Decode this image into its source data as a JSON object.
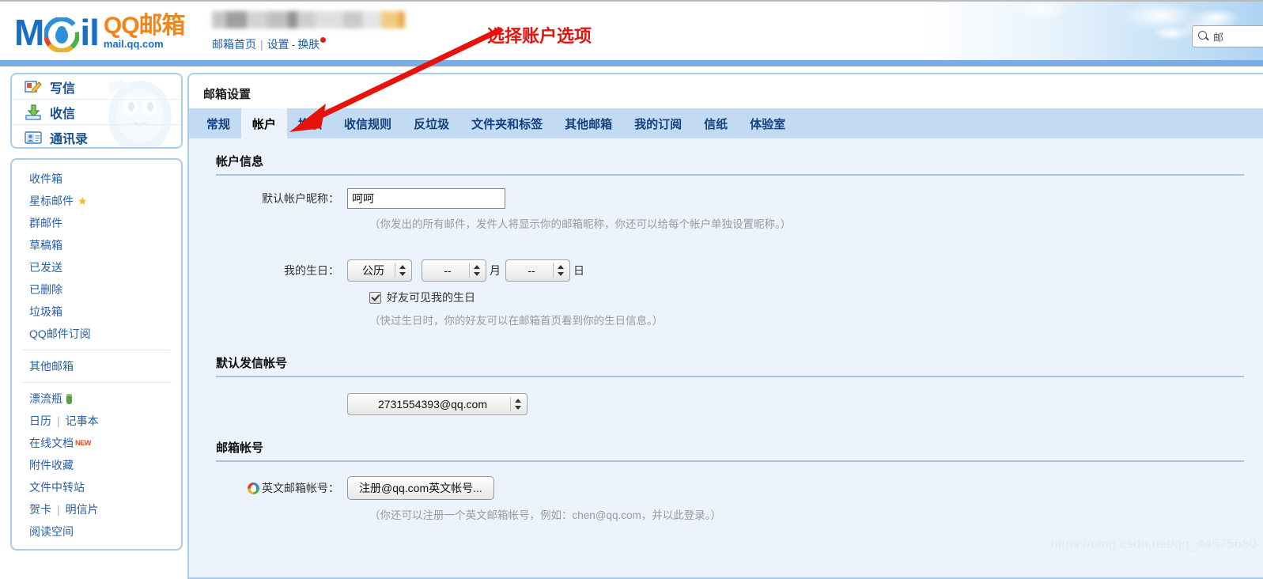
{
  "header": {
    "logo_m": "M",
    "logo_il": "il",
    "logo_qq": "QQ邮箱",
    "logo_url": "mail.qq.com",
    "links": {
      "home": "邮箱首页",
      "separator": "|",
      "settings": "设置",
      "dash": "-",
      "skin": "换肤"
    },
    "search_placeholder": "邮",
    "search_icon": "search-icon"
  },
  "sidebar": {
    "primary": [
      {
        "label": "写信",
        "icon": "compose-icon"
      },
      {
        "label": "收信",
        "icon": "inbox-download-icon"
      },
      {
        "label": "通讯录",
        "icon": "contacts-icon"
      }
    ],
    "folders": [
      {
        "label": "收件箱"
      },
      {
        "label": "星标邮件",
        "badge": "star-icon"
      },
      {
        "label": "群邮件"
      },
      {
        "label": "草稿箱"
      },
      {
        "label": "已发送"
      },
      {
        "label": "已删除"
      },
      {
        "label": "垃圾箱"
      },
      {
        "label": "QQ邮件订阅"
      }
    ],
    "other": [
      {
        "label": "其他邮箱"
      }
    ],
    "tools": [
      {
        "label": "漂流瓶",
        "badge": "bottle-icon"
      },
      {
        "label": "日历",
        "label2": "记事本",
        "sep": "|"
      },
      {
        "label": "在线文档",
        "tag": "NEW"
      },
      {
        "label": "附件收藏"
      },
      {
        "label": "文件中转站"
      },
      {
        "label": "贺卡",
        "label2": "明信片",
        "sep": "|"
      },
      {
        "label": "阅读空间"
      }
    ]
  },
  "main": {
    "page_title": "邮箱设置",
    "tabs": [
      {
        "label": "常规",
        "active": false
      },
      {
        "label": "帐户",
        "active": true
      },
      {
        "label": "换肤",
        "active": false
      },
      {
        "label": "收信规则",
        "active": false
      },
      {
        "label": "反垃圾",
        "active": false
      },
      {
        "label": "文件夹和标签",
        "active": false
      },
      {
        "label": "其他邮箱",
        "active": false
      },
      {
        "label": "我的订阅",
        "active": false
      },
      {
        "label": "信纸",
        "active": false
      },
      {
        "label": "体验室",
        "active": false
      }
    ],
    "sections": {
      "account_info": {
        "heading": "帐户信息",
        "nickname_label": "默认帐户昵称：",
        "nickname_value": "呵呵",
        "nickname_hint": "（你发出的所有邮件，发件人将显示你的邮箱昵称，你还可以给每个帐户单独设置昵称。）",
        "birthday_label": "我的生日：",
        "birthday_calendar": "公历",
        "birthday_month": "--",
        "birthday_month_unit": "月",
        "birthday_day": "--",
        "birthday_day_unit": "日",
        "birthday_checkbox_label": "好友可见我的生日",
        "birthday_checkbox_checked": true,
        "birthday_hint": "（快过生日时，你的好友可以在邮箱首页看到你的生日信息。）"
      },
      "default_sender": {
        "heading": "默认发信帐号",
        "selected_account": "2731554393@qq.com"
      },
      "mail_account": {
        "heading": "邮箱帐号",
        "english_label": "英文邮箱帐号：",
        "english_icon": "qq-logo-icon",
        "english_button": "注册@qq.com英文帐号...",
        "english_hint": "（你还可以注册一个英文邮箱帐号，例如：chen@qq.com，并以此登录。）"
      }
    }
  },
  "annotation": {
    "text": "选择账户选项",
    "color": "#e8120c"
  },
  "watermark": {
    "text": "https://blog.csdn.net/qq_44575680"
  },
  "colors": {
    "accent_blue": "#7cace4",
    "panel_border": "#a8cdee",
    "tab_bar": "#c3daf3",
    "content_bg": "#edf3fc",
    "link": "#2b5f9e",
    "annotation_red": "#e8120c"
  }
}
